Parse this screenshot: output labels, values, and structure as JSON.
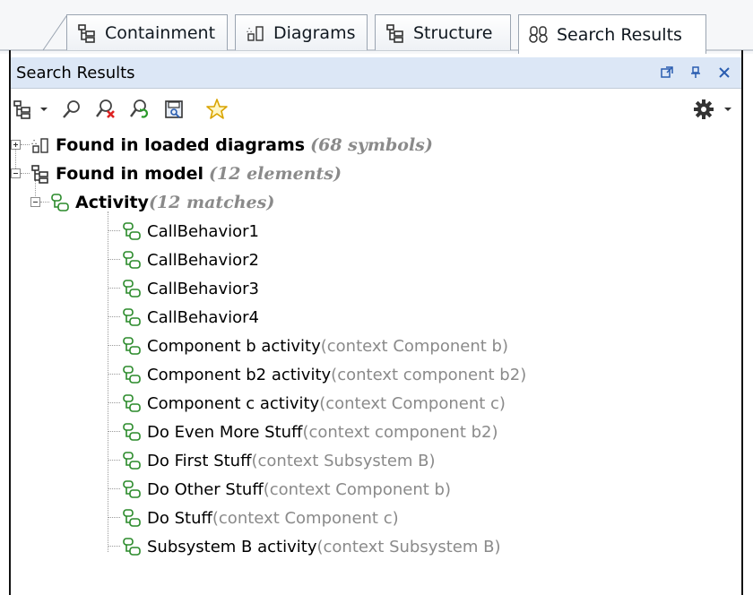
{
  "tabs": [
    {
      "label": "Containment",
      "icon": "containment-icon"
    },
    {
      "label": "Diagrams",
      "icon": "diagrams-icon"
    },
    {
      "label": "Structure",
      "icon": "structure-icon"
    },
    {
      "label": "Search Results",
      "icon": "search-results-icon",
      "active": true
    }
  ],
  "panel": {
    "title": "Search Results",
    "controls": [
      "float-icon",
      "pin-icon",
      "close-icon"
    ]
  },
  "toolbar": {
    "buttons": [
      "show-tree-icon",
      "dropdown-arrow-icon",
      "find-icon",
      "clear-results-icon",
      "refresh-search-icon",
      "save-results-icon",
      "favorite-star-icon"
    ],
    "options": "gear-icon"
  },
  "tree": {
    "loaded": {
      "label": "Found in loaded diagrams",
      "hint": "(68 symbols)"
    },
    "model": {
      "label": "Found in model",
      "hint": "(12 elements)"
    },
    "activity": {
      "label": "Activity",
      "hint": "(12 matches)"
    },
    "items": [
      {
        "label": "CallBehavior1",
        "hint": ""
      },
      {
        "label": "CallBehavior2",
        "hint": ""
      },
      {
        "label": "CallBehavior3",
        "hint": ""
      },
      {
        "label": "CallBehavior4",
        "hint": ""
      },
      {
        "label": "Component b activity",
        "hint": "(context Component b)"
      },
      {
        "label": "Component b2 activity",
        "hint": "(context component b2)"
      },
      {
        "label": "Component c activity",
        "hint": "(context Component c)"
      },
      {
        "label": "Do Even More Stuff",
        "hint": "(context component b2)"
      },
      {
        "label": "Do First Stuff",
        "hint": "(context Subsystem B)"
      },
      {
        "label": "Do Other Stuff",
        "hint": "(context Component b)"
      },
      {
        "label": "Do Stuff",
        "hint": "(context Component c)"
      },
      {
        "label": "Subsystem B activity",
        "hint": "(context Subsystem B)"
      }
    ]
  }
}
